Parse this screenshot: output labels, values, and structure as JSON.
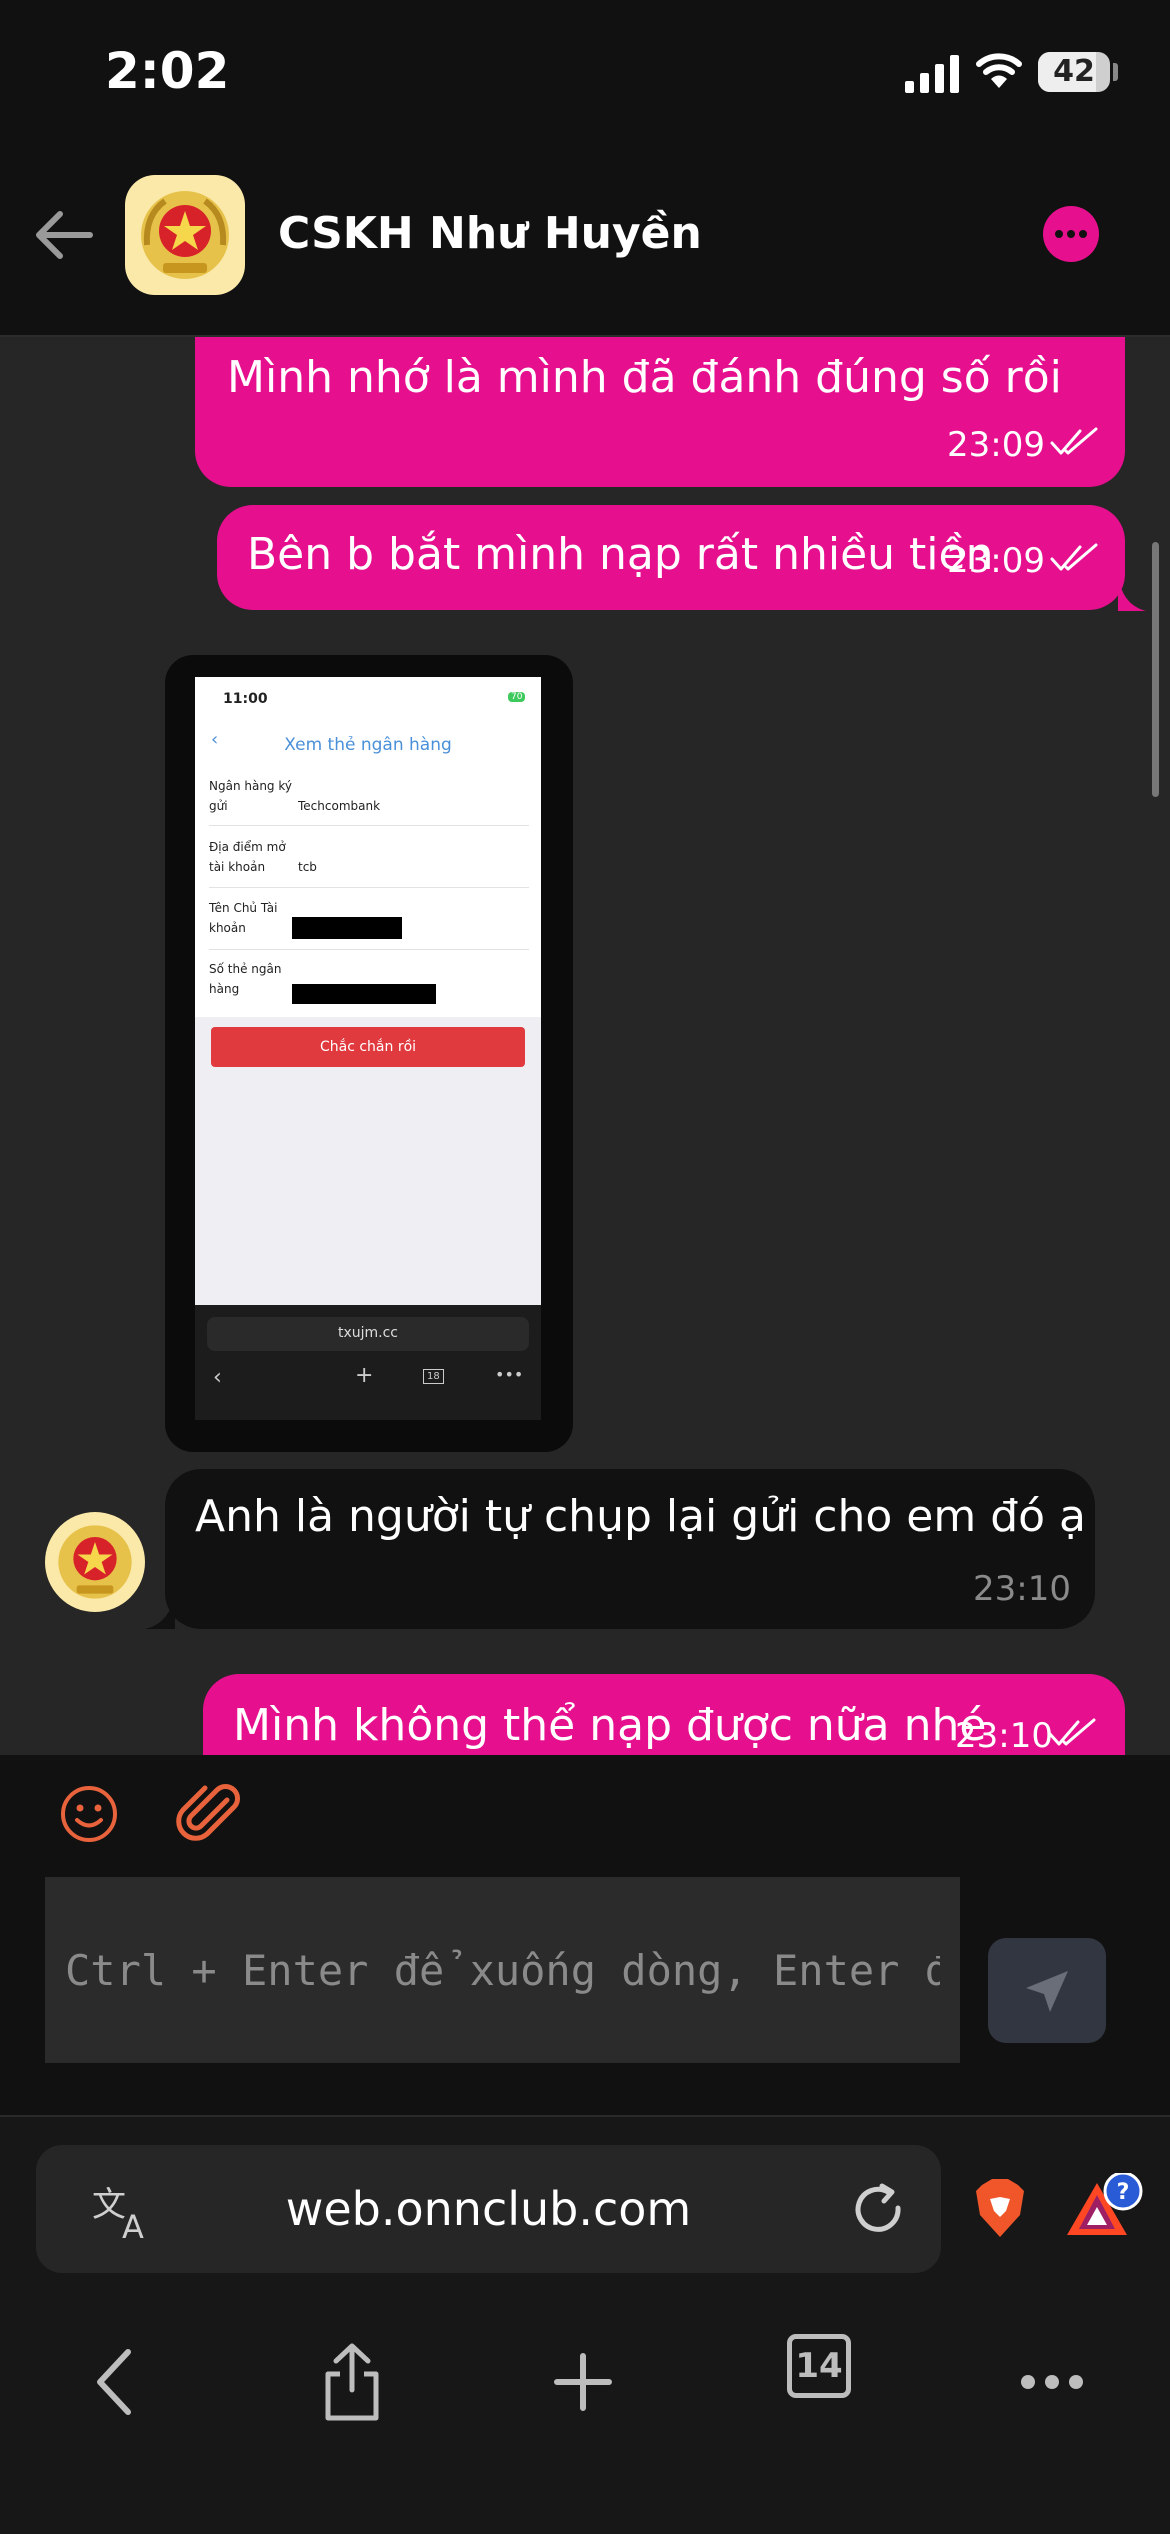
{
  "status_bar": {
    "time": "2:02",
    "battery": "42"
  },
  "header": {
    "contact_name": "CSKH Như Huyền"
  },
  "messages": [
    {
      "direction": "outgoing",
      "text": "Mình nhớ là mình đã đánh đúng số rồi",
      "time": "23:09",
      "status": "read"
    },
    {
      "direction": "outgoing",
      "text": "Bên b bắt mình nạp rất nhiều tiền",
      "time": "23:09",
      "status": "read"
    },
    {
      "direction": "incoming",
      "type": "image"
    },
    {
      "direction": "incoming",
      "text": "Anh là người tự chụp lại gửi cho em đó ạ",
      "time": "23:10"
    },
    {
      "direction": "outgoing",
      "text": "Mình không thể nạp được nữa nhé",
      "time": "23:10",
      "status": "read"
    }
  ],
  "shared_screenshot": {
    "time": "11:00",
    "battery": "70",
    "title": "Xem thẻ ngân hàng",
    "rows": [
      {
        "label_line1": "Ngân hàng ký",
        "label_line2": "gửi",
        "value": "Techcombank"
      },
      {
        "label_line1": "Địa điểm mở",
        "label_line2": "tài khoản",
        "value": "tcb"
      },
      {
        "label_line1": "Tên Chủ Tài",
        "label_line2": "khoản",
        "value": ""
      },
      {
        "label_line1": "Số thẻ ngân",
        "label_line2": "hàng",
        "value": ""
      }
    ],
    "confirm_button": "Chắc chắn rồi",
    "url": "txujm.cc",
    "tab_count": "18"
  },
  "composer": {
    "placeholder": "Ctrl + Enter để xuống dòng, Enter để gửi"
  },
  "browser": {
    "url": "web.onnclub.com",
    "tab_count": "14",
    "bat_badge": "?"
  },
  "colors": {
    "accent": "#e6108f",
    "background": "#262626",
    "bar": "#111111",
    "icon_orange": "#e8633c"
  }
}
